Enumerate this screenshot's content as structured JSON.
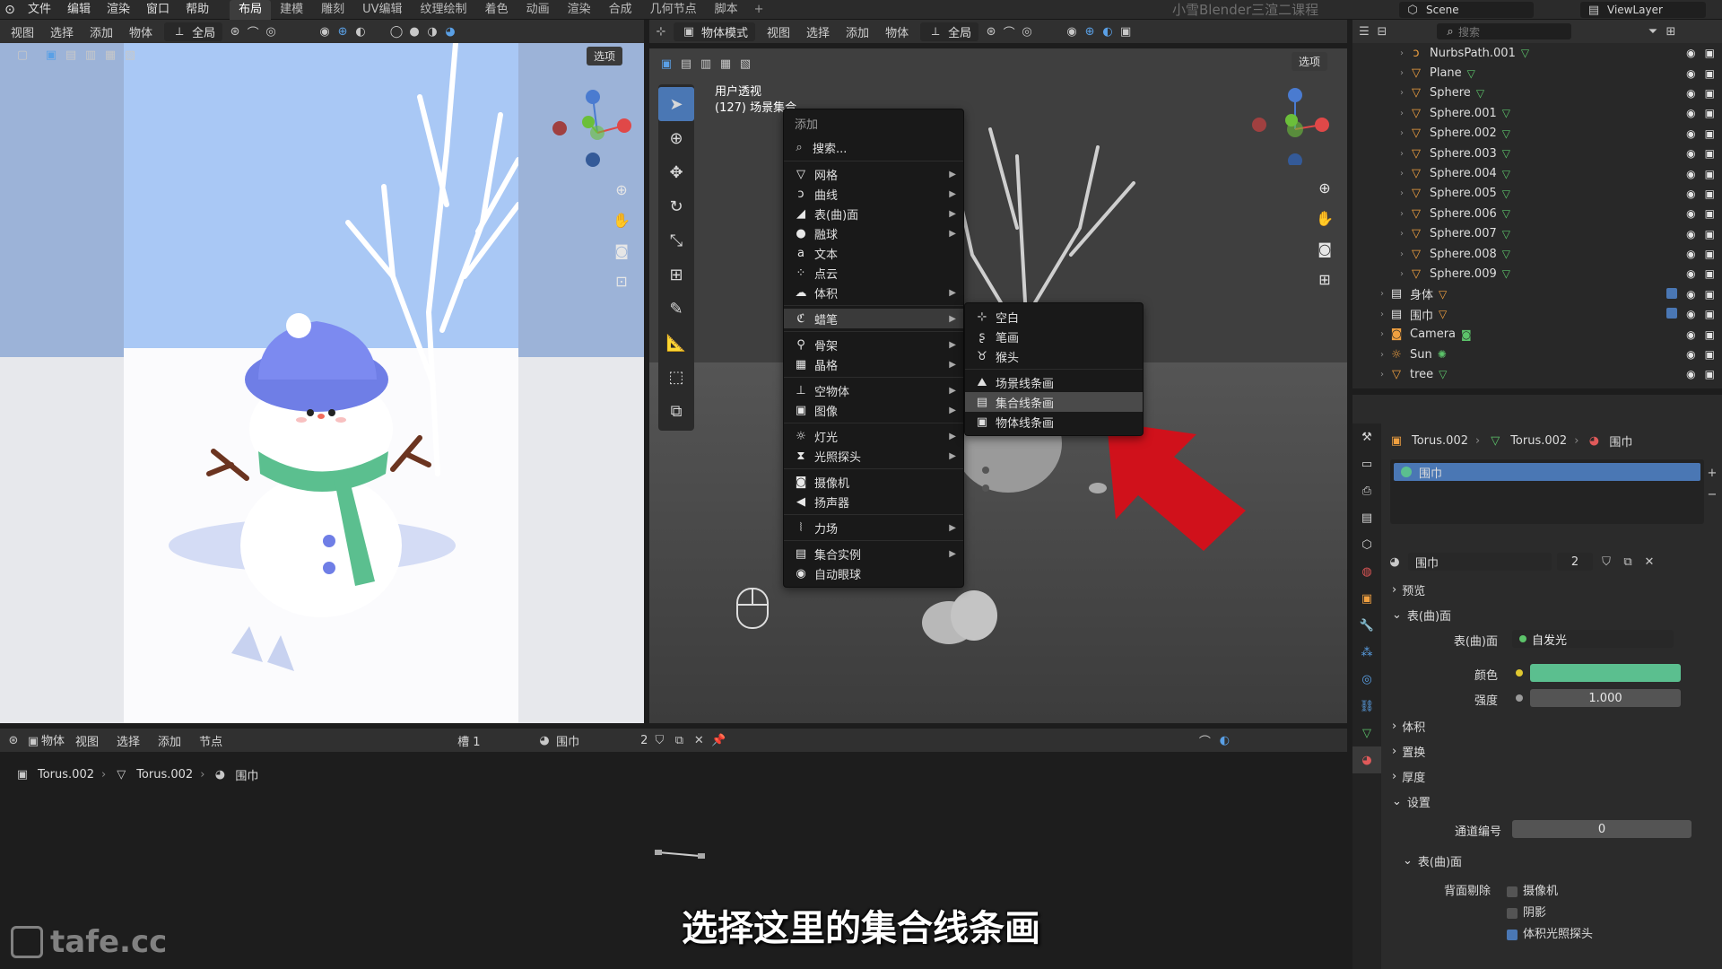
{
  "topbar": {
    "menus": [
      "文件",
      "编辑",
      "渲染",
      "窗口",
      "帮助"
    ],
    "workspaces": [
      "布局",
      "建模",
      "雕刻",
      "UV编辑",
      "纹理绘制",
      "着色",
      "动画",
      "渲染",
      "合成",
      "几何节点",
      "脚本"
    ],
    "active_workspace": "布局",
    "add_tab": "+",
    "course_title": "小雪Blender三渲二课程",
    "scene": "Scene",
    "view_layer": "ViewLayer"
  },
  "left_viewport": {
    "header_items": [
      "视图",
      "选择",
      "添加",
      "物体"
    ],
    "transform": "全局",
    "options": "选项"
  },
  "right_viewport": {
    "mode": "物体模式",
    "header_items": [
      "视图",
      "选择",
      "添加",
      "物体"
    ],
    "transform": "全局",
    "options": "选项",
    "view_name": "用户透视",
    "collection_info": "(127) 场景集合"
  },
  "add_menu": {
    "title": "添加",
    "search": "搜索...",
    "items": [
      {
        "label": "网格",
        "icon": "mesh-icon",
        "glyph": "▽",
        "submenu": true
      },
      {
        "label": "曲线",
        "icon": "curve-icon",
        "glyph": "ↄ",
        "submenu": true
      },
      {
        "label": "表(曲)面",
        "icon": "surface-icon",
        "glyph": "◢",
        "submenu": true
      },
      {
        "label": "融球",
        "icon": "metaball-icon",
        "glyph": "●",
        "submenu": true
      },
      {
        "label": "文本",
        "icon": "text-icon",
        "glyph": "a",
        "submenu": false
      },
      {
        "label": "点云",
        "icon": "pointcloud-icon",
        "glyph": "⁘",
        "submenu": false
      },
      {
        "label": "体积",
        "icon": "volume-icon",
        "glyph": "☁",
        "submenu": true
      },
      {
        "label": "蜡笔",
        "icon": "grease-pencil-icon",
        "glyph": "ℭ",
        "submenu": true,
        "highlight": true
      },
      {
        "label": "骨架",
        "icon": "armature-icon",
        "glyph": "⚲",
        "submenu": true
      },
      {
        "label": "晶格",
        "icon": "lattice-icon",
        "glyph": "▦",
        "submenu": true
      },
      {
        "label": "空物体",
        "icon": "empty-icon",
        "glyph": "⊥",
        "submenu": true
      },
      {
        "label": "图像",
        "icon": "image-icon",
        "glyph": "▣",
        "submenu": true
      },
      {
        "label": "灯光",
        "icon": "light-icon",
        "glyph": "☼",
        "submenu": true
      },
      {
        "label": "光照探头",
        "icon": "lightprobe-icon",
        "glyph": "⧗",
        "submenu": true
      },
      {
        "label": "摄像机",
        "icon": "camera-icon",
        "glyph": "◙",
        "submenu": false
      },
      {
        "label": "扬声器",
        "icon": "speaker-icon",
        "glyph": "◀",
        "submenu": false
      },
      {
        "label": "力场",
        "icon": "forcefield-icon",
        "glyph": "⦚",
        "submenu": true
      },
      {
        "label": "集合实例",
        "icon": "collection-instance-icon",
        "glyph": "▤",
        "submenu": true
      },
      {
        "label": "自动眼球",
        "icon": "auto-eye-icon",
        "glyph": "◉",
        "submenu": false
      }
    ]
  },
  "grease_pencil_submenu": {
    "items": [
      {
        "label": "空白",
        "icon": "blank-stroke-icon",
        "glyph": "⊹"
      },
      {
        "label": "笔画",
        "icon": "stroke-icon",
        "glyph": "ʂ"
      },
      {
        "label": "猴头",
        "icon": "monkey-icon",
        "glyph": "♉"
      },
      {
        "label": "场景线条画",
        "icon": "scene-lineart-icon",
        "glyph": "⛰"
      },
      {
        "label": "集合线条画",
        "icon": "collection-lineart-icon",
        "glyph": "▤",
        "highlight": true
      },
      {
        "label": "物体线条画",
        "icon": "object-lineart-icon",
        "glyph": "▣"
      }
    ]
  },
  "outliner": {
    "rows": [
      {
        "name": "NurbsPath.001",
        "type": "curve",
        "depth": 2,
        "restrict": false
      },
      {
        "name": "Plane",
        "type": "mesh",
        "depth": 2,
        "restrict": false
      },
      {
        "name": "Sphere",
        "type": "mesh",
        "depth": 2,
        "restrict": false
      },
      {
        "name": "Sphere.001",
        "type": "mesh",
        "depth": 2,
        "restrict": false
      },
      {
        "name": "Sphere.002",
        "type": "mesh",
        "depth": 2,
        "restrict": false
      },
      {
        "name": "Sphere.003",
        "type": "mesh",
        "depth": 2,
        "restrict": false
      },
      {
        "name": "Sphere.004",
        "type": "mesh",
        "depth": 2,
        "restrict": false
      },
      {
        "name": "Sphere.005",
        "type": "mesh",
        "depth": 2,
        "restrict": false
      },
      {
        "name": "Sphere.006",
        "type": "mesh",
        "depth": 2,
        "restrict": false
      },
      {
        "name": "Sphere.007",
        "type": "mesh",
        "depth": 2,
        "restrict": false
      },
      {
        "name": "Sphere.008",
        "type": "mesh",
        "depth": 2,
        "restrict": false
      },
      {
        "name": "Sphere.009",
        "type": "mesh",
        "depth": 2,
        "restrict": false
      },
      {
        "name": "身体",
        "type": "collection",
        "depth": 1,
        "restrict": true
      },
      {
        "name": "围巾",
        "type": "collection",
        "depth": 1,
        "restrict": true
      },
      {
        "name": "Camera",
        "type": "camera",
        "depth": 1,
        "restrict": false
      },
      {
        "name": "Sun",
        "type": "light",
        "depth": 1,
        "restrict": false
      },
      {
        "name": "tree",
        "type": "mesh",
        "depth": 1,
        "restrict": false
      }
    ],
    "search_placeholder": "搜索"
  },
  "properties": {
    "search_placeholder": "搜索",
    "breadcrumb": [
      "Torus.002",
      "Torus.002",
      "围巾"
    ],
    "material_slot": "围巾",
    "material_name": "围巾",
    "user_count": "2",
    "panels": {
      "preview": "预览",
      "surface": "表(曲)面",
      "volume": "体积",
      "displacement": "置换",
      "thickness": "厚度",
      "settings": "设置",
      "surface_sub": "表(曲)面"
    },
    "surface_label": "表(曲)面",
    "surface_value": "自发光",
    "color_label": "颜色",
    "color_value": "#5bbf8f",
    "strength_label": "强度",
    "strength_value": "1.000",
    "pass_index_label": "通道编号",
    "pass_index_value": "0",
    "backface_label": "背面剔除",
    "checks": [
      {
        "label": "摄像机",
        "checked": false
      },
      {
        "label": "阴影",
        "checked": false
      },
      {
        "label": "体积光照探头",
        "checked": true
      }
    ]
  },
  "bottom_editor": {
    "type": "物体",
    "header_items": [
      "视图",
      "选择",
      "添加",
      "节点"
    ],
    "slot": "槽 1",
    "material": "围巾",
    "user_count": "2",
    "breadcrumb": [
      "Torus.002",
      "Torus.002",
      "围巾"
    ]
  },
  "subtitle": "选择这里的集合线条画",
  "site_watermark": "tafe.cc",
  "colors": {
    "accent": "#4a77b4",
    "highlight_arrow": "#d0111b",
    "scarf_green": "#5bbf8f",
    "hat_blue": "#6f7ee6"
  }
}
